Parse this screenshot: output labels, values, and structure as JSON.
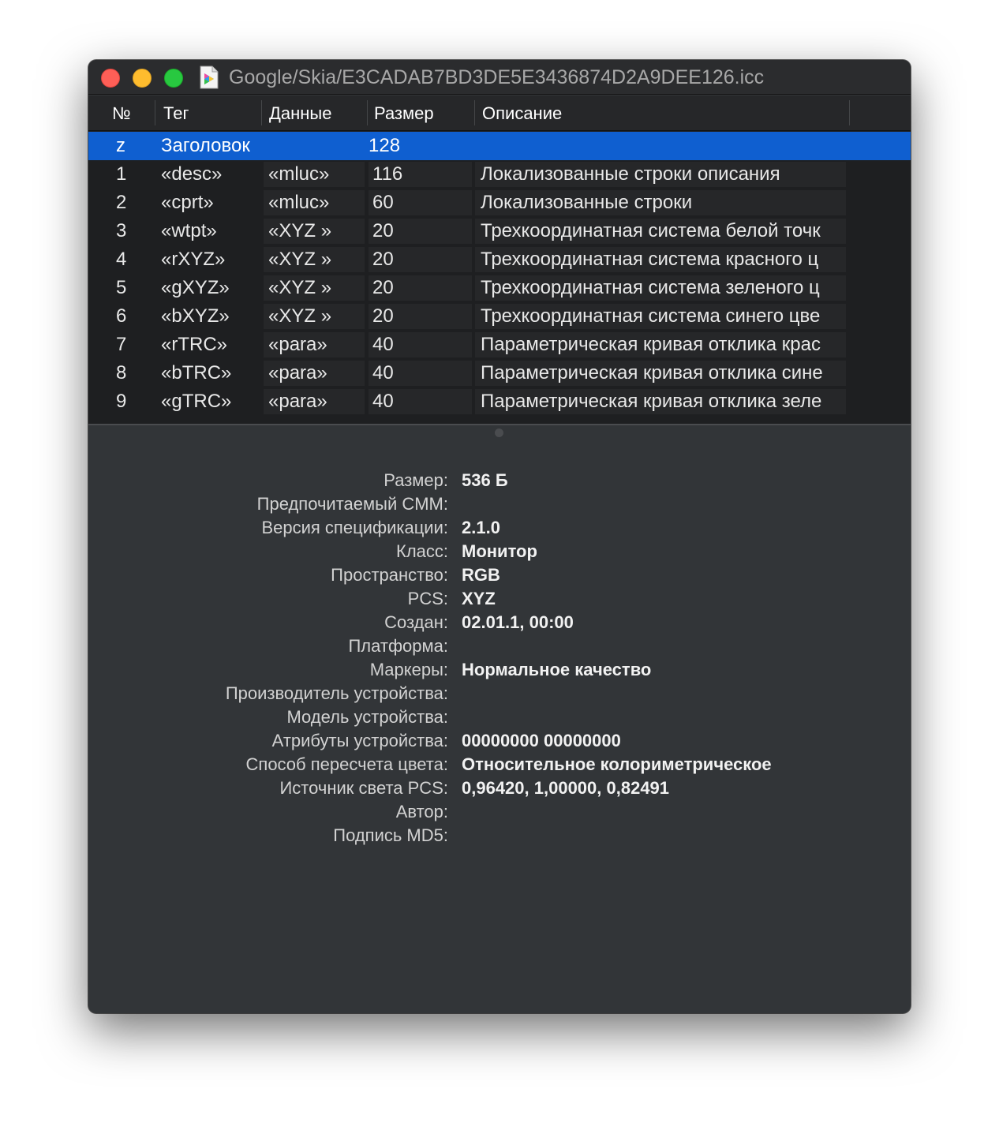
{
  "window": {
    "title": "Google/Skia/E3CADAB7BD3DE5E3436874D2A9DEE126.icc"
  },
  "table": {
    "headers": {
      "num": "№",
      "tag": "Тег",
      "data": "Данные",
      "size": "Размер",
      "description": "Описание"
    },
    "rows": [
      {
        "num": "z",
        "tag": "Заголовок",
        "data": "",
        "size": "128",
        "description": "",
        "selected": true
      },
      {
        "num": "1",
        "tag": "«desc»",
        "data": "«mluc»",
        "size": "116",
        "description": "Локализованные строки описания"
      },
      {
        "num": "2",
        "tag": "«cprt»",
        "data": "«mluc»",
        "size": "60",
        "description": "Локализованные строки"
      },
      {
        "num": "3",
        "tag": "«wtpt»",
        "data": "«XYZ »",
        "size": "20",
        "description": "Трехкоординатная система белой точк"
      },
      {
        "num": "4",
        "tag": "«rXYZ»",
        "data": "«XYZ »",
        "size": "20",
        "description": "Трехкоординатная система красного ц"
      },
      {
        "num": "5",
        "tag": "«gXYZ»",
        "data": "«XYZ »",
        "size": "20",
        "description": "Трехкоординатная система зеленого ц"
      },
      {
        "num": "6",
        "tag": "«bXYZ»",
        "data": "«XYZ »",
        "size": "20",
        "description": "Трехкоординатная система синего цве"
      },
      {
        "num": "7",
        "tag": "«rTRC»",
        "data": "«para»",
        "size": "40",
        "description": "Параметрическая кривая отклика крас"
      },
      {
        "num": "8",
        "tag": "«bTRC»",
        "data": "«para»",
        "size": "40",
        "description": "Параметрическая кривая отклика сине"
      },
      {
        "num": "9",
        "tag": "«gTRC»",
        "data": "«para»",
        "size": "40",
        "description": "Параметрическая кривая отклика зеле"
      }
    ]
  },
  "details": [
    {
      "label": "Размер:",
      "value": "536 Б"
    },
    {
      "label": "Предпочитаемый CMM:",
      "value": ""
    },
    {
      "label": "Версия спецификации:",
      "value": "2.1.0"
    },
    {
      "label": "Класс:",
      "value": "Монитор"
    },
    {
      "label": "Пространство:",
      "value": "RGB"
    },
    {
      "label": "PCS:",
      "value": "XYZ"
    },
    {
      "label": "Создан:",
      "value": "02.01.1, 00:00"
    },
    {
      "label": "Платформа:",
      "value": ""
    },
    {
      "label": "Маркеры:",
      "value": "Нормальное качество"
    },
    {
      "label": "Производитель устройства:",
      "value": ""
    },
    {
      "label": "Модель устройства:",
      "value": ""
    },
    {
      "label": "Атрибуты устройства:",
      "value": "00000000 00000000"
    },
    {
      "label": "Способ пересчета цвета:",
      "value": "Относительное колориметрическое"
    },
    {
      "label": "Источник света PCS:",
      "value": "0,96420, 1,00000, 0,82491"
    },
    {
      "label": "Автор:",
      "value": ""
    },
    {
      "label": "Подпись MD5:",
      "value": ""
    }
  ],
  "colors": {
    "selection": "#0f5fd0",
    "window_bg": "#323538",
    "table_bg": "#1e1f21"
  }
}
